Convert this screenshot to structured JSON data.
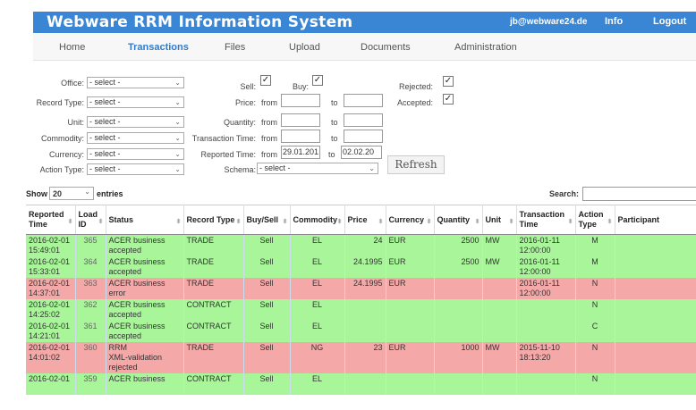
{
  "header": {
    "title": "Webware RRM Information System",
    "email": "jb@webware24.de",
    "info": "Info",
    "logout": "Logout"
  },
  "nav": {
    "home": "Home",
    "transactions": "Transactions",
    "files": "Files",
    "upload": "Upload",
    "documents": "Documents",
    "administration": "Administration"
  },
  "filters": {
    "office": {
      "label": "Office:",
      "value": "- select -"
    },
    "record_type": {
      "label": "Record Type:",
      "value": "- select -"
    },
    "unit": {
      "label": "Unit:",
      "value": "- select -"
    },
    "commodity": {
      "label": "Commodity:",
      "value": "- select -"
    },
    "currency": {
      "label": "Currency:",
      "value": "- select -"
    },
    "action_type": {
      "label": "Action Type:",
      "value": "- select -"
    },
    "sell_label": "Sell:",
    "buy_label": "Buy:",
    "price_label": "Price:",
    "quantity_label": "Quantity:",
    "transaction_time_label": "Transaction Time:",
    "reported_time_label": "Reported Time:",
    "from": "from",
    "to": "to",
    "reported_from": "29.01.201",
    "reported_to": "02.02.20",
    "schema_label": "Schema:",
    "schema_value": "- select -",
    "rejected_label": "Rejected:",
    "accepted_label": "Accepted:",
    "check": "✓",
    "refresh": "Refresh"
  },
  "list": {
    "show": "Show",
    "entries_count": "20",
    "entries": "entries",
    "search": "Search:"
  },
  "columns": [
    "Reported Time",
    "Load ID",
    "Status",
    "Record Type",
    "Buy/Sell",
    "Commodity",
    "Price",
    "Currency",
    "Quantity",
    "Unit",
    "Transaction Time",
    "Action Type",
    "Participant"
  ],
  "rows": [
    {
      "state": "ok",
      "date": "2016-02-01",
      "time": "15:49:01",
      "id": "365",
      "s1": "ACER business",
      "s2": "accepted",
      "s3": "",
      "rtype": "TRADE",
      "bs": "Sell",
      "comm": "EL",
      "price": "24",
      "cur": "EUR",
      "qty": "2500",
      "unit": "MW",
      "tdate": "2016-01-11",
      "ttime": "12:00:00",
      "act": "M"
    },
    {
      "state": "ok",
      "date": "2016-02-01",
      "time": "15:33:01",
      "id": "364",
      "s1": "ACER business",
      "s2": "accepted",
      "s3": "",
      "rtype": "TRADE",
      "bs": "Sell",
      "comm": "EL",
      "price": "24.1995",
      "cur": "EUR",
      "qty": "2500",
      "unit": "MW",
      "tdate": "2016-01-11",
      "ttime": "12:00:00",
      "act": "M"
    },
    {
      "state": "err",
      "date": "2016-02-01",
      "time": "14:37:01",
      "id": "363",
      "s1": "ACER business",
      "s2": "error",
      "s3": "",
      "rtype": "TRADE",
      "bs": "Sell",
      "comm": "EL",
      "price": "24.1995",
      "cur": "EUR",
      "qty": "",
      "unit": "",
      "tdate": "2016-01-11",
      "ttime": "12:00:00",
      "act": "N"
    },
    {
      "state": "ok",
      "date": "2016-02-01",
      "time": "14:25:02",
      "id": "362",
      "s1": "ACER business",
      "s2": "accepted",
      "s3": "",
      "rtype": "CONTRACT",
      "bs": "Sell",
      "comm": "EL",
      "price": "",
      "cur": "",
      "qty": "",
      "unit": "",
      "tdate": "",
      "ttime": "",
      "act": "N"
    },
    {
      "state": "ok",
      "date": "2016-02-01",
      "time": "14:21:01",
      "id": "361",
      "s1": "ACER business",
      "s2": "accepted",
      "s3": "",
      "rtype": "CONTRACT",
      "bs": "Sell",
      "comm": "EL",
      "price": "",
      "cur": "",
      "qty": "",
      "unit": "",
      "tdate": "",
      "ttime": "",
      "act": "C"
    },
    {
      "state": "err",
      "date": "2016-02-01",
      "time": "14:01:02",
      "id": "360",
      "s1": "RRM",
      "s2": "XML-validation",
      "s3": "rejected",
      "rtype": "TRADE",
      "bs": "Sell",
      "comm": "NG",
      "price": "23",
      "cur": "EUR",
      "qty": "1000",
      "unit": "MW",
      "tdate": "2015-11-10",
      "ttime": "18:13:20",
      "act": "N"
    },
    {
      "state": "ok",
      "date": "2016-02-01",
      "time": "",
      "id": "359",
      "s1": "ACER business",
      "s2": "",
      "s3": "",
      "rtype": "CONTRACT",
      "bs": "Sell",
      "comm": "EL",
      "price": "",
      "cur": "",
      "qty": "",
      "unit": "",
      "tdate": "",
      "ttime": "",
      "act": "N"
    }
  ]
}
